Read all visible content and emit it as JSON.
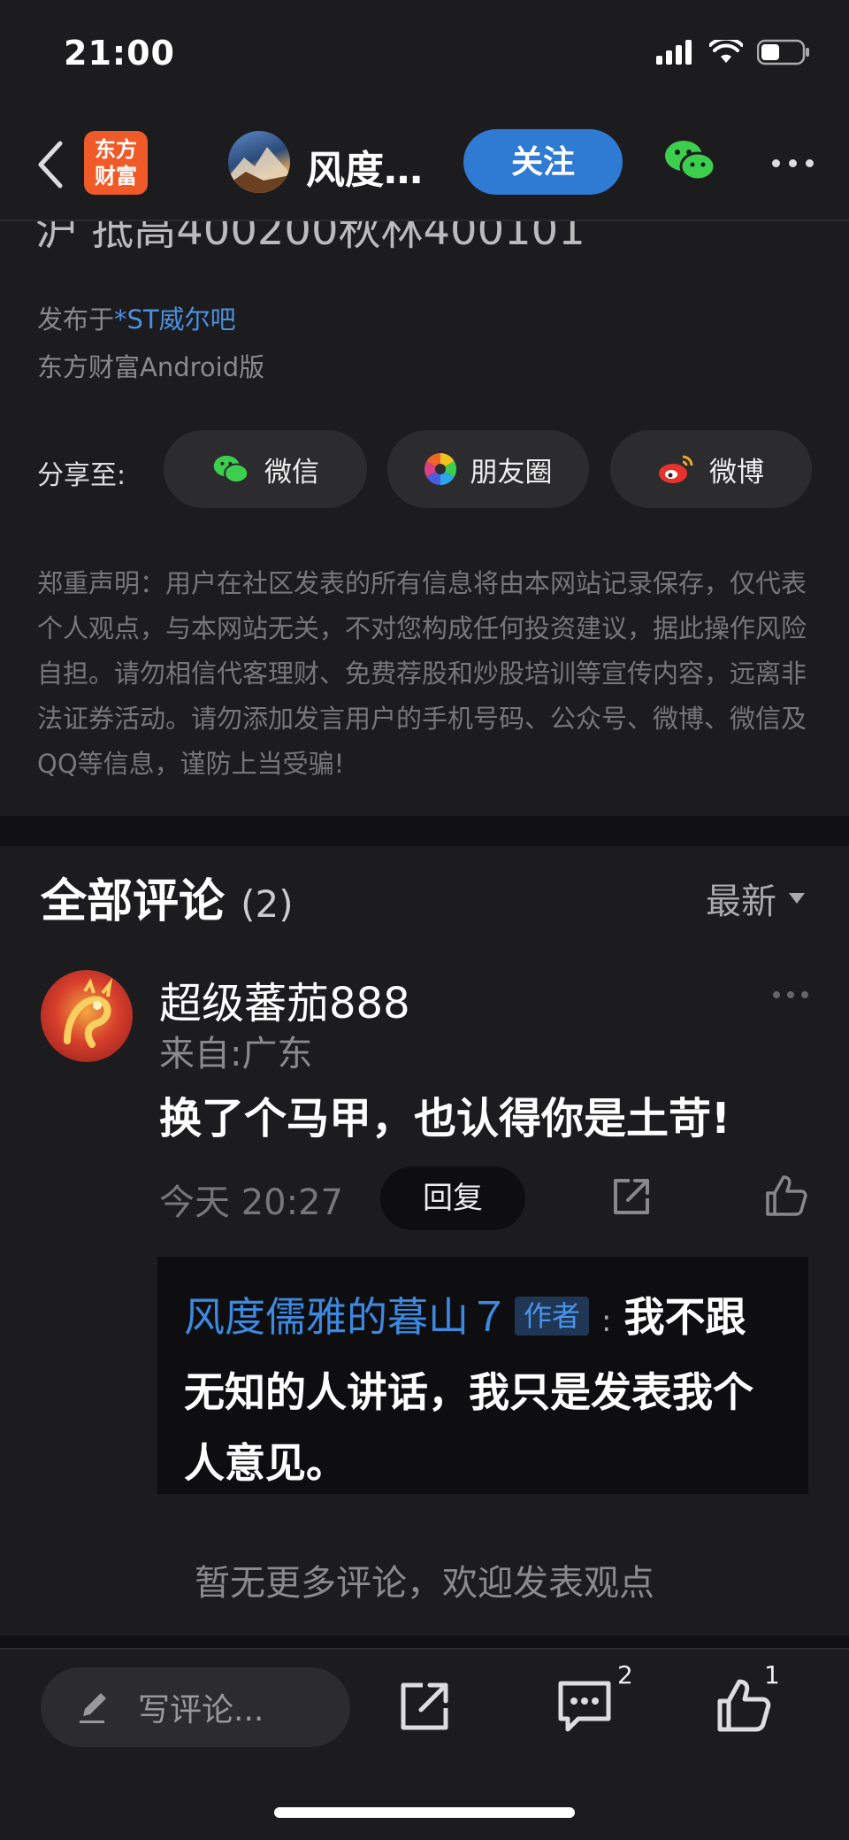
{
  "status": {
    "time": "21:00"
  },
  "nav": {
    "logo_line1": "东方",
    "logo_line2": "财富",
    "author": "风度…",
    "follow_label": "关注"
  },
  "post": {
    "cutoff_title": "沪  抵高400200秋林400101",
    "posted_in_prefix": "发布于",
    "posted_in_bar": "*ST威尔吧",
    "posted_via": "东方财富Android版"
  },
  "share": {
    "label": "分享至:",
    "wechat": "微信",
    "moments": "朋友圈",
    "weibo": "微博"
  },
  "disclaimer": "郑重声明：用户在社区发表的所有信息将由本网站记录保存，仅代表个人观点，与本网站无关，不对您构成任何投资建议，据此操作风险自担。请勿相信代客理财、免费荐股和炒股培训等宣传内容，远离非法证券活动。请勿添加发言用户的手机号码、公众号、微博、微信及QQ等信息，谨防上当受骗!",
  "comments": {
    "title": "全部评论",
    "count": "(2)",
    "sort_label": "最新",
    "items": [
      {
        "user": "超级蕃茄888",
        "location": "来自:广东",
        "text": "换了个马甲，也认得你是土苛!",
        "time": "今天 20:27",
        "reply_label": "回复",
        "reply": {
          "author": "风度儒雅的暮山７",
          "tag": "作者",
          "colon": ":",
          "text": "我不跟无知的人讲话，我只是发表我个人意见。"
        }
      }
    ],
    "no_more": "暂无更多评论，欢迎发表观点"
  },
  "bottom": {
    "input_placeholder": "写评论...",
    "comment_count": "2",
    "like_count": "1"
  },
  "colors": {
    "background": "#1c1c1e",
    "accent_blue": "#2f7ad2",
    "link_blue": "#4a8fe0",
    "brand_orange": "#f05a28",
    "wechat_green": "#3ccf4e"
  }
}
